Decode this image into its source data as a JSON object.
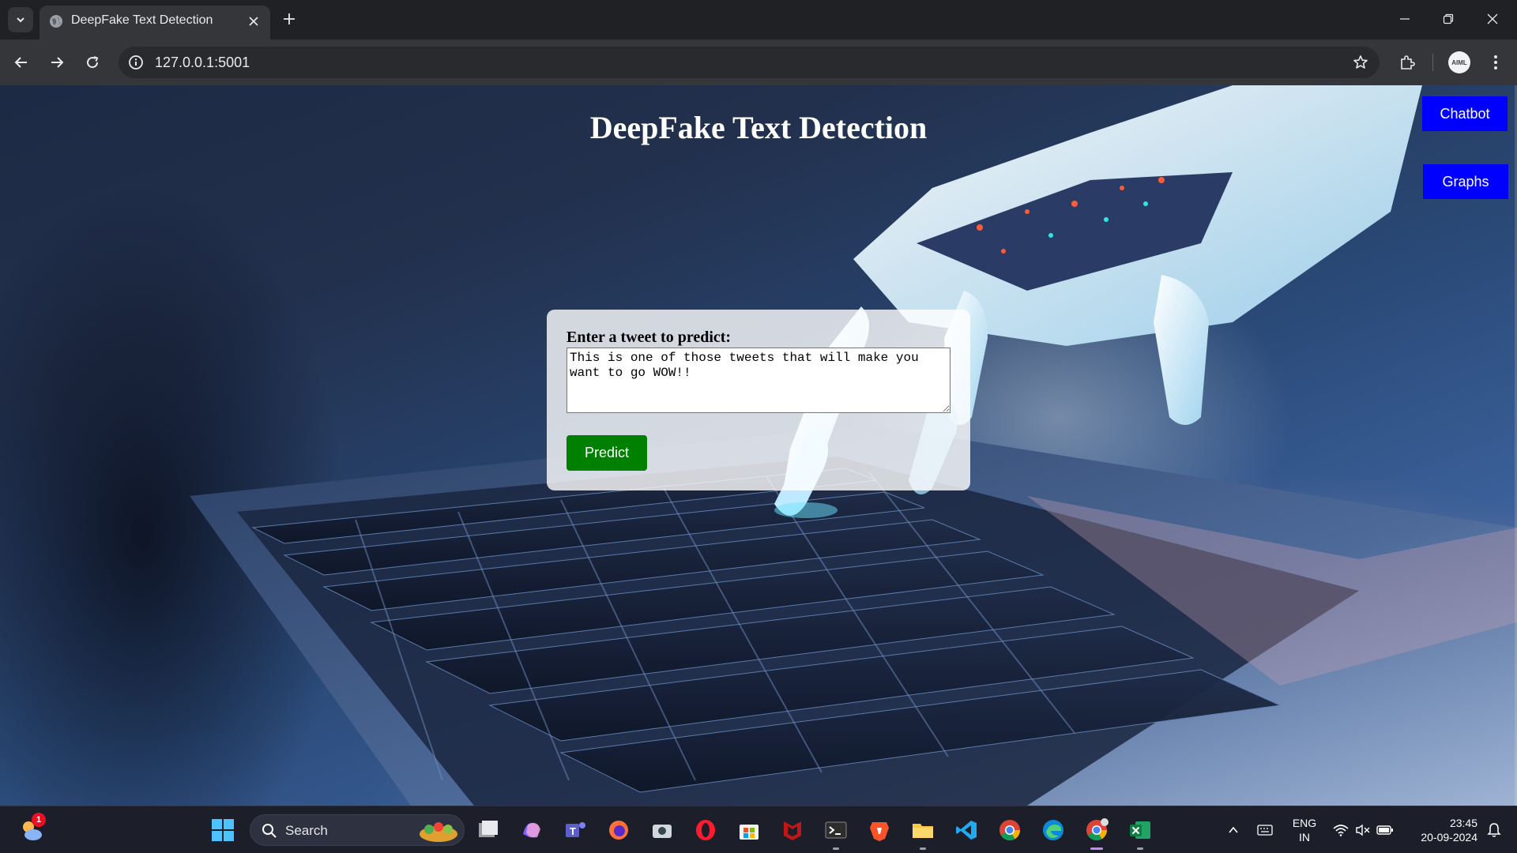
{
  "browser": {
    "tab": {
      "title": "DeepFake Text Detection"
    },
    "address_bar": {
      "url": "127.0.0.1:5001"
    },
    "profile": {
      "initials": "AIML"
    }
  },
  "page": {
    "title": "DeepFake Text Detection",
    "chatbot_button": "Chatbot",
    "graphs_button": "Graphs",
    "form": {
      "label": "Enter a tweet to predict:",
      "tweet_value": "This is one of those tweets that will make you want to go WOW!!",
      "predict_button": "Predict"
    }
  },
  "colors": {
    "nav_buttons": "#0000ff",
    "predict_button": "#008000"
  },
  "taskbar": {
    "weather_badge": "1",
    "search_placeholder": "Search",
    "apps": [
      "windows-start-icon",
      "file-explorer-icon",
      "copilot-icon",
      "teams-icon",
      "firefox-icon",
      "camera-icon",
      "opera-icon",
      "microsoft-store-icon",
      "mcafee-icon",
      "terminal-icon",
      "brave-icon",
      "folder-icon",
      "vscode-icon",
      "chrome-icon",
      "edge-icon",
      "chrome-profile-icon",
      "excel-icon"
    ],
    "tray": {
      "language_line1": "ENG",
      "language_line2": "IN",
      "time": "23:45",
      "date": "20-09-2024"
    }
  }
}
